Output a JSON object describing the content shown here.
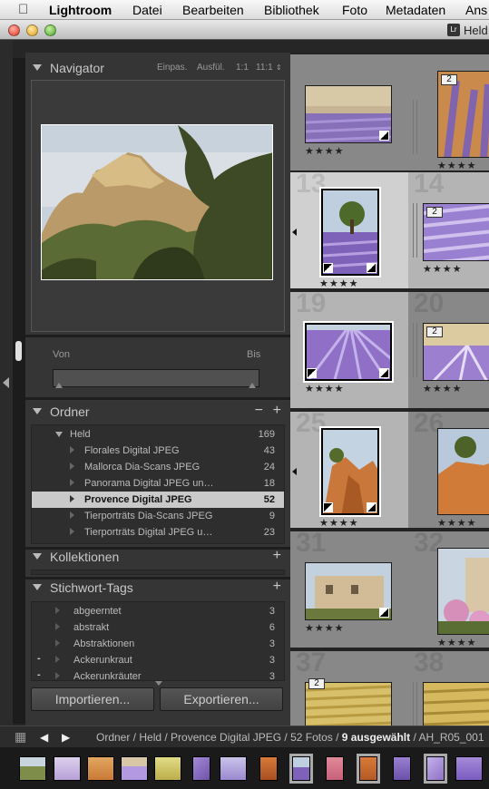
{
  "menubar": {
    "app": "Lightroom",
    "items": [
      "Datei",
      "Bearbeiten",
      "Bibliothek",
      "Foto",
      "Metadaten",
      "Ans"
    ]
  },
  "window": {
    "title": "Held",
    "badge": "Lr"
  },
  "navigator": {
    "title": "Navigator",
    "options": [
      "Einpas.",
      "Ausfül.",
      "1:1",
      "11:1"
    ]
  },
  "filter": {
    "from_label": "Von",
    "to_label": "Bis"
  },
  "folders": {
    "title": "Ordner",
    "minus": "−",
    "plus": "+",
    "root": {
      "label": "Held",
      "count": "169"
    },
    "items": [
      {
        "label": "Florales Digital JPEG",
        "count": "43"
      },
      {
        "label": "Mallorca Dia-Scans JPEG",
        "count": "24"
      },
      {
        "label": "Panorama Digital JPEG un…",
        "count": "18"
      },
      {
        "label": "Provence Digital JPEG",
        "count": "52"
      },
      {
        "label": "Tierporträts Dia-Scans JPEG",
        "count": "9"
      },
      {
        "label": "Tierporträts Digital JPEG u…",
        "count": "23"
      }
    ]
  },
  "collections": {
    "title": "Kollektionen",
    "plus": "+"
  },
  "keywords": {
    "title": "Stichwort-Tags",
    "plus": "+",
    "items": [
      {
        "label": "abgeerntet",
        "count": "3",
        "mark": ""
      },
      {
        "label": "abstrakt",
        "count": "6",
        "mark": ""
      },
      {
        "label": "Abstraktionen",
        "count": "3",
        "mark": ""
      },
      {
        "label": "Ackerunkraut",
        "count": "3",
        "mark": "-"
      },
      {
        "label": "Ackerunkräuter",
        "count": "3",
        "mark": "-"
      }
    ]
  },
  "buttons": {
    "import": "Importieren...",
    "export": "Exportieren..."
  },
  "grid": {
    "stars": "★★★★",
    "stack_count": "2"
  },
  "statusbar": {
    "path": "Ordner / Held / Provence Digital JPEG / 52 Fotos / ",
    "selected": "9 ausgewählt",
    "file": " / AH_R05_001"
  },
  "colors": {
    "lavender": "#8a6fc4",
    "sky": "#b9c6da",
    "rock": "#c9773b",
    "selected_row": "#c9c9c9"
  }
}
